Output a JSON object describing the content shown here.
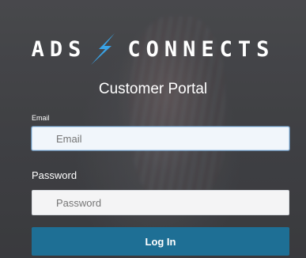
{
  "brand": {
    "left_text": "ADS",
    "right_text": "CONNECTS",
    "icon": "lightning-bolt-icon",
    "accent_color": "#3aa3e6"
  },
  "portal": {
    "title": "Customer Portal"
  },
  "form": {
    "email_label": "Email",
    "email_placeholder": "Email",
    "password_label": "Password",
    "password_placeholder": "Password",
    "login_label": "Log In"
  },
  "colors": {
    "button": "#1e6f95",
    "focus_border": "#bcd7ef"
  }
}
